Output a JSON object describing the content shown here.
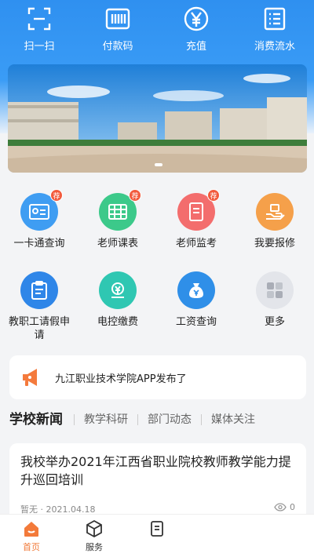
{
  "top_actions": [
    {
      "label": "扫一扫",
      "icon": "scan-icon"
    },
    {
      "label": "付款码",
      "icon": "payment-code-icon"
    },
    {
      "label": "充值",
      "icon": "yuan-icon"
    },
    {
      "label": "消费流水",
      "icon": "list-icon"
    }
  ],
  "grid": [
    {
      "label": "一卡通查询",
      "icon": "card-icon",
      "badge": "荐",
      "color": "#3f9df2"
    },
    {
      "label": "老师课表",
      "icon": "timetable-icon",
      "badge": "荐",
      "color": "#3cc98a"
    },
    {
      "label": "老师监考",
      "icon": "exam-icon",
      "badge": "荐",
      "color": "#f36d6d"
    },
    {
      "label": "我要报修",
      "icon": "repair-icon",
      "badge": "",
      "color": "#f5a04a"
    },
    {
      "label": "教职工请假申请",
      "icon": "leave-icon",
      "badge": "",
      "color": "#2f86e8"
    },
    {
      "label": "电控缴费",
      "icon": "electric-icon",
      "badge": "",
      "color": "#2fc7b2"
    },
    {
      "label": "工资查询",
      "icon": "salary-icon",
      "badge": "",
      "color": "#2f8fe8"
    },
    {
      "label": "更多",
      "icon": "more-icon",
      "badge": "",
      "color": "#d9dbe0"
    }
  ],
  "notice": {
    "text": "九江职业技术学院APP发布了"
  },
  "tabs": [
    "学校新闻",
    "教学科研",
    "部门动态",
    "媒体关注"
  ],
  "news": {
    "title": "我校举办2021年江西省职业院校教师教学能力提升巡回培训",
    "author": "暂无",
    "date": "2021.04.18",
    "views": "0"
  },
  "bottom_nav": [
    {
      "label": "首页",
      "icon": "home-icon",
      "active": true
    },
    {
      "label": "服务",
      "icon": "cube-icon",
      "active": false
    },
    {
      "label": "",
      "icon": "document-icon",
      "active": false
    }
  ]
}
